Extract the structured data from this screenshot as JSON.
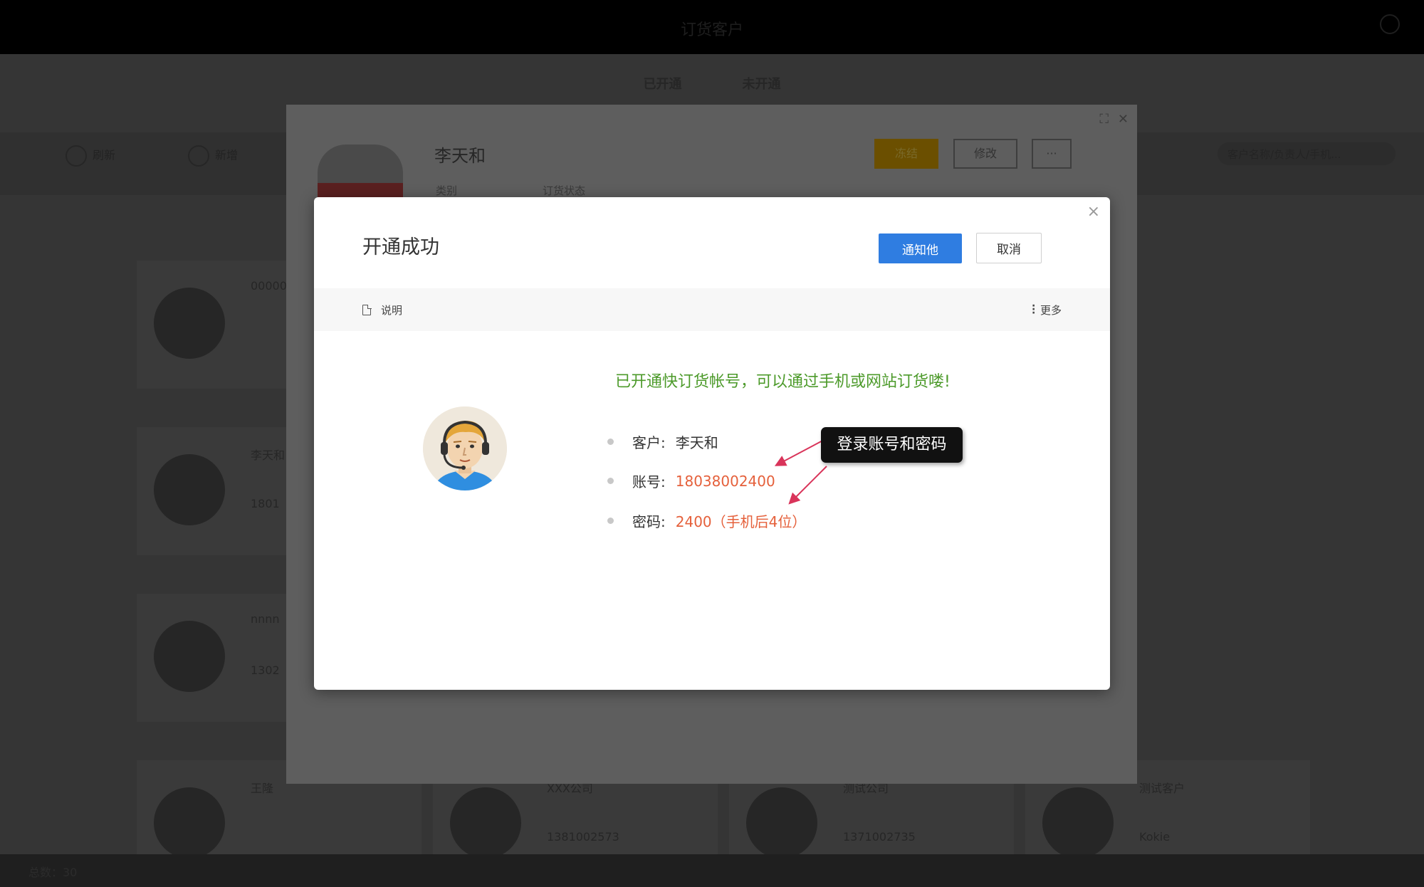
{
  "app": {
    "title": "订货客户",
    "status_tabs": [
      "已开通",
      "未开通"
    ],
    "toolbar": {
      "tool1": "刷新",
      "tool2": "新增",
      "search_placeholder": "客户名称/负责人/手机..."
    },
    "cards": [
      {
        "title": "00000",
        "sub": ""
      },
      {
        "title": "李天和",
        "sub": "1801"
      },
      {
        "title": "nnnn",
        "sub": "1302"
      },
      {
        "title": "王隆",
        "sub": ""
      },
      {
        "title": "XXX公司",
        "sub": "1381002573"
      },
      {
        "title": "测试公司",
        "sub": "1371002735"
      },
      {
        "title": "测试客户",
        "sub": "Kokie"
      }
    ],
    "footer": "总数：30"
  },
  "detail_modal": {
    "name": "李天和",
    "meta_category": "类别",
    "meta_status": "订货状态",
    "freeze_label": "冻结",
    "edit_label": "修改",
    "more_label": "···"
  },
  "success_modal": {
    "title": "开通成功",
    "notify_label": "通知他",
    "cancel_label": "取消",
    "close_label": "×",
    "doc_label": "说明",
    "more_label": "更多",
    "headline": "已开通快订货帐号，可以通过手机或网站订货喽!",
    "rows": [
      {
        "label": "客户:",
        "value": "李天和"
      },
      {
        "label": "账号:",
        "value": "18038002400"
      },
      {
        "label": "密码:",
        "value": "2400（手机后4位）"
      }
    ],
    "callout": "登录账号和密码"
  },
  "colors": {
    "primary": "#2f7de1",
    "success_text": "#4c9a2a",
    "highlight_text": "#e5603b",
    "arrow": "#d9345a"
  }
}
